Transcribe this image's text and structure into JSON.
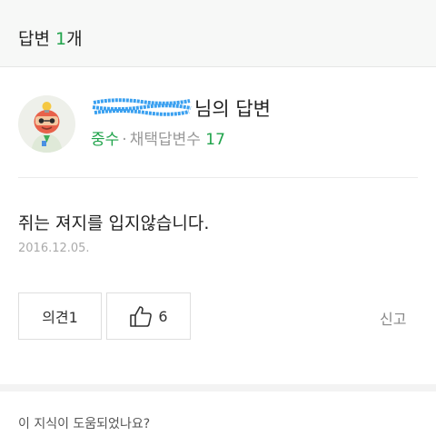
{
  "header": {
    "title": "답변",
    "count": "1",
    "unit": "개"
  },
  "answer_card": {
    "author_suffix": "님의 답변",
    "rank": "중수",
    "meta_separator": "·",
    "adopted_label": "채택답변수",
    "adopted_count": "17",
    "body": "쥐는 져지를 입지않습니다.",
    "date": "2016.12.05.",
    "opinion_button": "의견1",
    "like_count": "6",
    "report_label": "신고"
  },
  "footer": {
    "question": "이 지식이 도움되었나요?"
  },
  "colors": {
    "accent": "#1fa34a",
    "redaction": "#3aa0f0"
  },
  "icons": {
    "like": "thumbs-up-icon",
    "avatar": "character-avatar"
  }
}
